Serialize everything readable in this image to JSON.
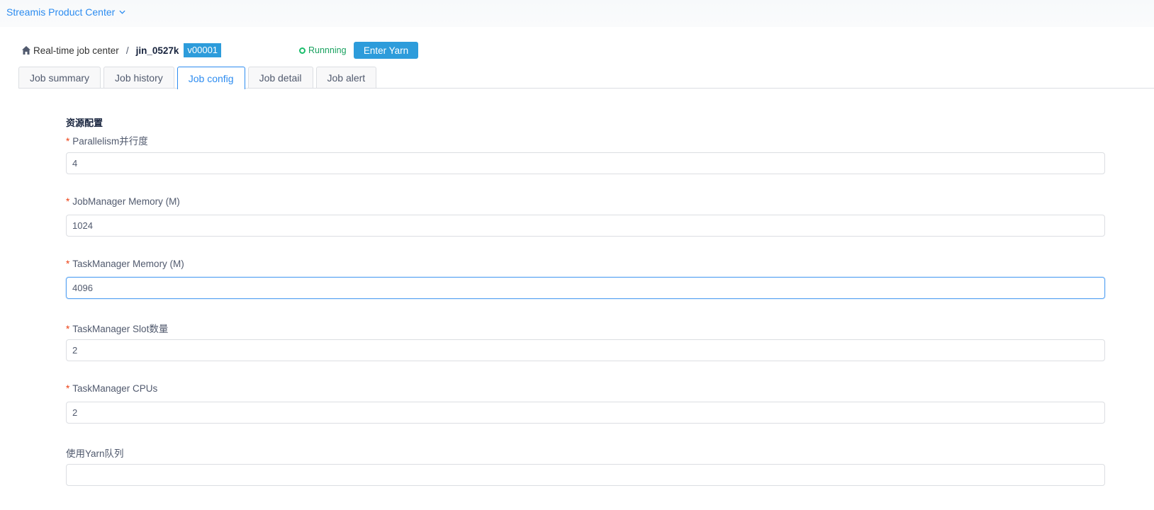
{
  "header": {
    "product_label": "Streamis Product Center"
  },
  "breadcrumb": {
    "root": "Real-time job center",
    "separator": "/",
    "job_name": "jin_0527k",
    "version": "v00001"
  },
  "status": {
    "label": "Runnning",
    "color": "#19be6b"
  },
  "actions": {
    "enter_yarn": "Enter Yarn"
  },
  "tabs": [
    {
      "label": "Job summary"
    },
    {
      "label": "Job history"
    },
    {
      "label": "Job config",
      "active": true
    },
    {
      "label": "Job detail"
    },
    {
      "label": "Job alert"
    }
  ],
  "form": {
    "section_title": "资源配置",
    "fields": [
      {
        "label": "Parallelism并行度",
        "required": "*",
        "value": "4"
      },
      {
        "label": "JobManager Memory (M)",
        "required": "*",
        "value": "1024"
      },
      {
        "label": "TaskManager Memory (M)",
        "required": "*",
        "value": "4096"
      },
      {
        "label": "TaskManager Slot数量",
        "required": "*",
        "value": "2"
      },
      {
        "label": "TaskManager CPUs",
        "required": "*",
        "value": "2"
      },
      {
        "label": "使用Yarn队列",
        "value": ""
      }
    ]
  },
  "colors": {
    "accent": "#2d8cf0",
    "button": "#2d9cdb",
    "required": "#ed4014"
  }
}
